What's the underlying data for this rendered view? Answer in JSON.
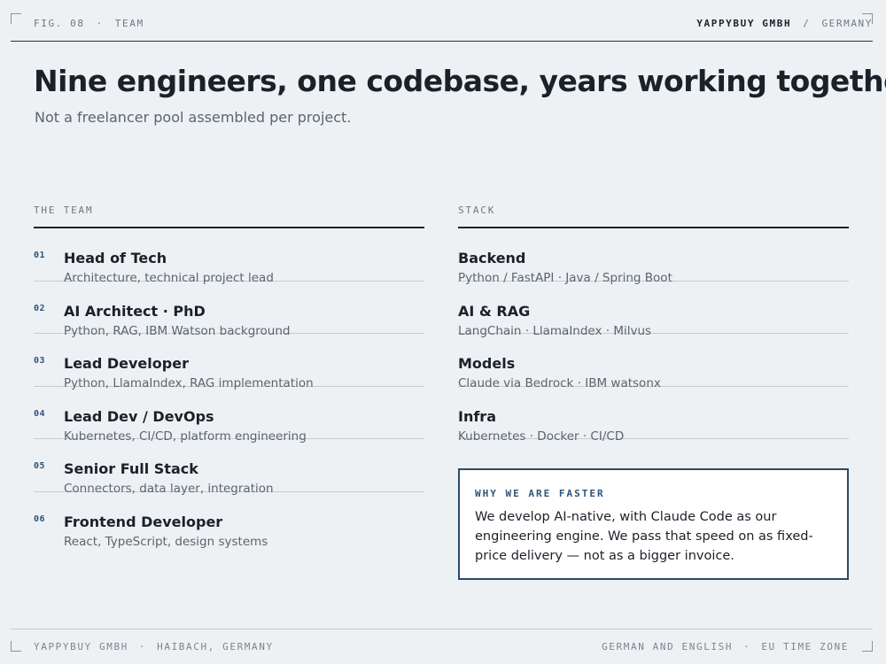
{
  "header": {
    "fig": "FIG. 08",
    "dot": "·",
    "section": "TEAM",
    "brand": "YAPPYBUY GMBH",
    "slash": "/",
    "country": "GERMANY"
  },
  "title": "Nine engineers, one codebase, years working together",
  "subtitle": "Not a freelancer pool assembled per project.",
  "team": {
    "heading": "THE TEAM",
    "members": [
      {
        "num": "01",
        "role": "Head of Tech",
        "desc": "Architecture, technical project lead"
      },
      {
        "num": "02",
        "role": "AI Architect  ·  PhD",
        "desc": "Python, RAG, IBM Watson background"
      },
      {
        "num": "03",
        "role": "Lead Developer",
        "desc": "Python, LlamaIndex, RAG implementation"
      },
      {
        "num": "04",
        "role": "Lead Dev / DevOps",
        "desc": "Kubernetes, CI/CD, platform engineering"
      },
      {
        "num": "05",
        "role": "Senior Full Stack",
        "desc": "Connectors, data layer, integration"
      },
      {
        "num": "06",
        "role": "Frontend Developer",
        "desc": "React, TypeScript, design systems"
      }
    ]
  },
  "stack": {
    "heading": "STACK",
    "items": [
      {
        "name": "Backend",
        "desc": "Python / FastAPI  ·  Java / Spring Boot"
      },
      {
        "name": "AI & RAG",
        "desc": "LangChain  ·  LlamaIndex  ·  Milvus"
      },
      {
        "name": "Models",
        "desc": "Claude via Bedrock  ·  IBM watsonx"
      },
      {
        "name": "Infra",
        "desc": "Kubernetes  ·  Docker  ·  CI/CD"
      }
    ]
  },
  "callout": {
    "label": "WHY WE ARE FASTER",
    "text": "We develop AI-native, with Claude Code as our engineering engine. We pass that speed on as fixed-price delivery — not as a bigger invoice."
  },
  "footer": {
    "company": "YAPPYBUY GMBH",
    "dot": "·",
    "location": "HAIBACH, GERMANY",
    "languages": "GERMAN AND ENGLISH",
    "timezone": "EU TIME ZONE"
  }
}
